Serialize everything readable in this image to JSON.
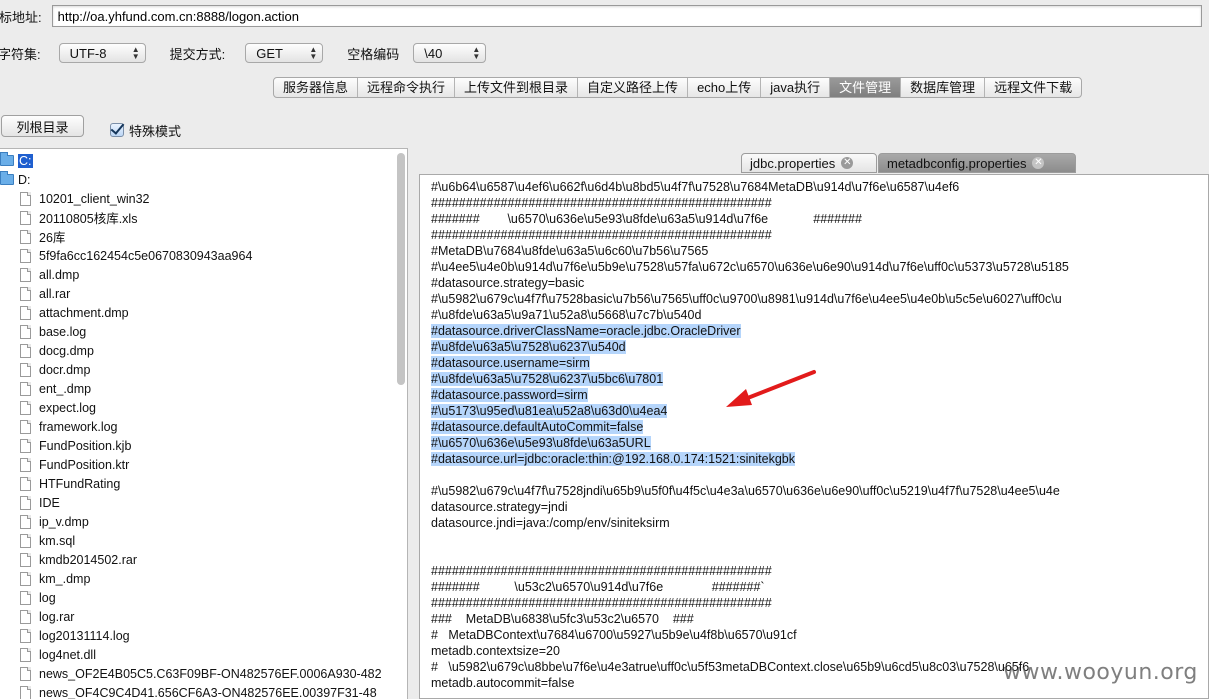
{
  "url_bar": {
    "label": "标地址:",
    "value": "http://oa.yhfund.com.cn:8888/logon.action"
  },
  "options_row": {
    "charset_label": "字符集:",
    "charset_value": "UTF-8",
    "submit_label": "提交方式:",
    "submit_value": "GET",
    "space_label": "空格编码",
    "space_value": "\\40"
  },
  "function_tabs": [
    "服务器信息",
    "远程命令执行",
    "上传文件到根目录",
    "自定义路径上传",
    "echo上传",
    "java执行",
    "文件管理",
    "数据库管理",
    "远程文件下载"
  ],
  "active_function_tab": "文件管理",
  "list_root_button": "列根目录",
  "special_mode_label": "特殊模式",
  "tree": {
    "drives": [
      "C:",
      "D:"
    ],
    "files": [
      "10201_client_win32",
      "20110805核库.xls",
      "26库",
      "5f9fa6cc162454c5e0670830943aa964",
      "all.dmp",
      "all.rar",
      "attachment.dmp",
      "base.log",
      "docg.dmp",
      "docr.dmp",
      "ent_.dmp",
      "expect.log",
      "framework.log",
      "FundPosition.kjb",
      "FundPosition.ktr",
      "HTFundRating",
      "IDE",
      "ip_v.dmp",
      "km.sql",
      "kmdb2014502.rar",
      "km_.dmp",
      "log",
      "log.rar",
      "log20131114.log",
      "log4net.dll",
      "news_OF2E4B05C5.C63F09BF-ON482576EF.0006A930-482",
      "news_OF4C9C4D41.656CF6A3-ON482576EE.00397F31-48"
    ]
  },
  "editor_tabs": [
    "jdbc.properties",
    "metadbconfig.properties"
  ],
  "editor_lines": [
    {
      "t": "#\\u6b64\\u6587\\u4ef6\\u662f\\u6d4b\\u8bd5\\u4f7f\\u7528\\u7684MetaDB\\u914d\\u7f6e\\u6587\\u4ef6",
      "h": false
    },
    {
      "t": "#################################################",
      "h": false
    },
    {
      "t": "#######        \\u6570\\u636e\\u5e93\\u8fde\\u63a5\\u914d\\u7f6e             #######",
      "h": false
    },
    {
      "t": "#################################################",
      "h": false
    },
    {
      "t": "#MetaDB\\u7684\\u8fde\\u63a5\\u6c60\\u7b56\\u7565",
      "h": false
    },
    {
      "t": "#\\u4ee5\\u4e0b\\u914d\\u7f6e\\u5b9e\\u7528\\u57fa\\u672c\\u6570\\u636e\\u6e90\\u914d\\u7f6e\\uff0c\\u5373\\u5728\\u5185",
      "h": false
    },
    {
      "t": "#datasource.strategy=basic",
      "h": false
    },
    {
      "t": "#\\u5982\\u679c\\u4f7f\\u7528basic\\u7b56\\u7565\\uff0c\\u9700\\u8981\\u914d\\u7f6e\\u4ee5\\u4e0b\\u5c5e\\u6027\\uff0c\\u",
      "h": false
    },
    {
      "t": "#\\u8fde\\u63a5\\u9a71\\u52a8\\u5668\\u7c7b\\u540d",
      "h": false
    },
    {
      "t": "#datasource.driverClassName=oracle.jdbc.OracleDriver",
      "h": true
    },
    {
      "t": "#\\u8fde\\u63a5\\u7528\\u6237\\u540d",
      "h": true
    },
    {
      "t": "#datasource.username=sirm",
      "h": true
    },
    {
      "t": "#\\u8fde\\u63a5\\u7528\\u6237\\u5bc6\\u7801",
      "h": true
    },
    {
      "t": "#datasource.password=sirm",
      "h": true
    },
    {
      "t": "#\\u5173\\u95ed\\u81ea\\u52a8\\u63d0\\u4ea4",
      "h": true
    },
    {
      "t": "#datasource.defaultAutoCommit=false",
      "h": true
    },
    {
      "t": "#\\u6570\\u636e\\u5e93\\u8fde\\u63a5URL",
      "h": true
    },
    {
      "t": "#datasource.url=jdbc:oracle:thin:@192.168.0.174:1521:sinitekgbk",
      "h": true
    },
    {
      "t": "",
      "h": false
    },
    {
      "t": "#\\u5982\\u679c\\u4f7f\\u7528jndi\\u65b9\\u5f0f\\u4f5c\\u4e3a\\u6570\\u636e\\u6e90\\uff0c\\u5219\\u4f7f\\u7528\\u4ee5\\u4e",
      "h": false
    },
    {
      "t": "datasource.strategy=jndi",
      "h": false
    },
    {
      "t": "datasource.jndi=java:/comp/env/siniteksirm",
      "h": false
    },
    {
      "t": "",
      "h": false
    },
    {
      "t": "",
      "h": false
    },
    {
      "t": "#################################################",
      "h": false
    },
    {
      "t": "#######          \\u53c2\\u6570\\u914d\\u7f6e              #######`",
      "h": false
    },
    {
      "t": "#################################################",
      "h": false
    },
    {
      "t": "###    MetaDB\\u6838\\u5fc3\\u53c2\\u6570    ###",
      "h": false
    },
    {
      "t": "#   MetaDBContext\\u7684\\u6700\\u5927\\u5b9e\\u4f8b\\u6570\\u91cf",
      "h": false
    },
    {
      "t": "metadb.contextsize=20",
      "h": false
    },
    {
      "t": "#   \\u5982\\u679c\\u8bbe\\u7f6e\\u4e3atrue\\uff0c\\u5f53metaDBContext.close\\u65b9\\u6cd5\\u8c03\\u7528\\u65f6",
      "h": false
    },
    {
      "t": "metadb.autocommit=false",
      "h": false
    }
  ],
  "watermark": "www.wooyun.org",
  "colors": {
    "highlight": "#b5d5fb",
    "arrow": "#e21b1b",
    "selection": "#1f5fcf"
  }
}
